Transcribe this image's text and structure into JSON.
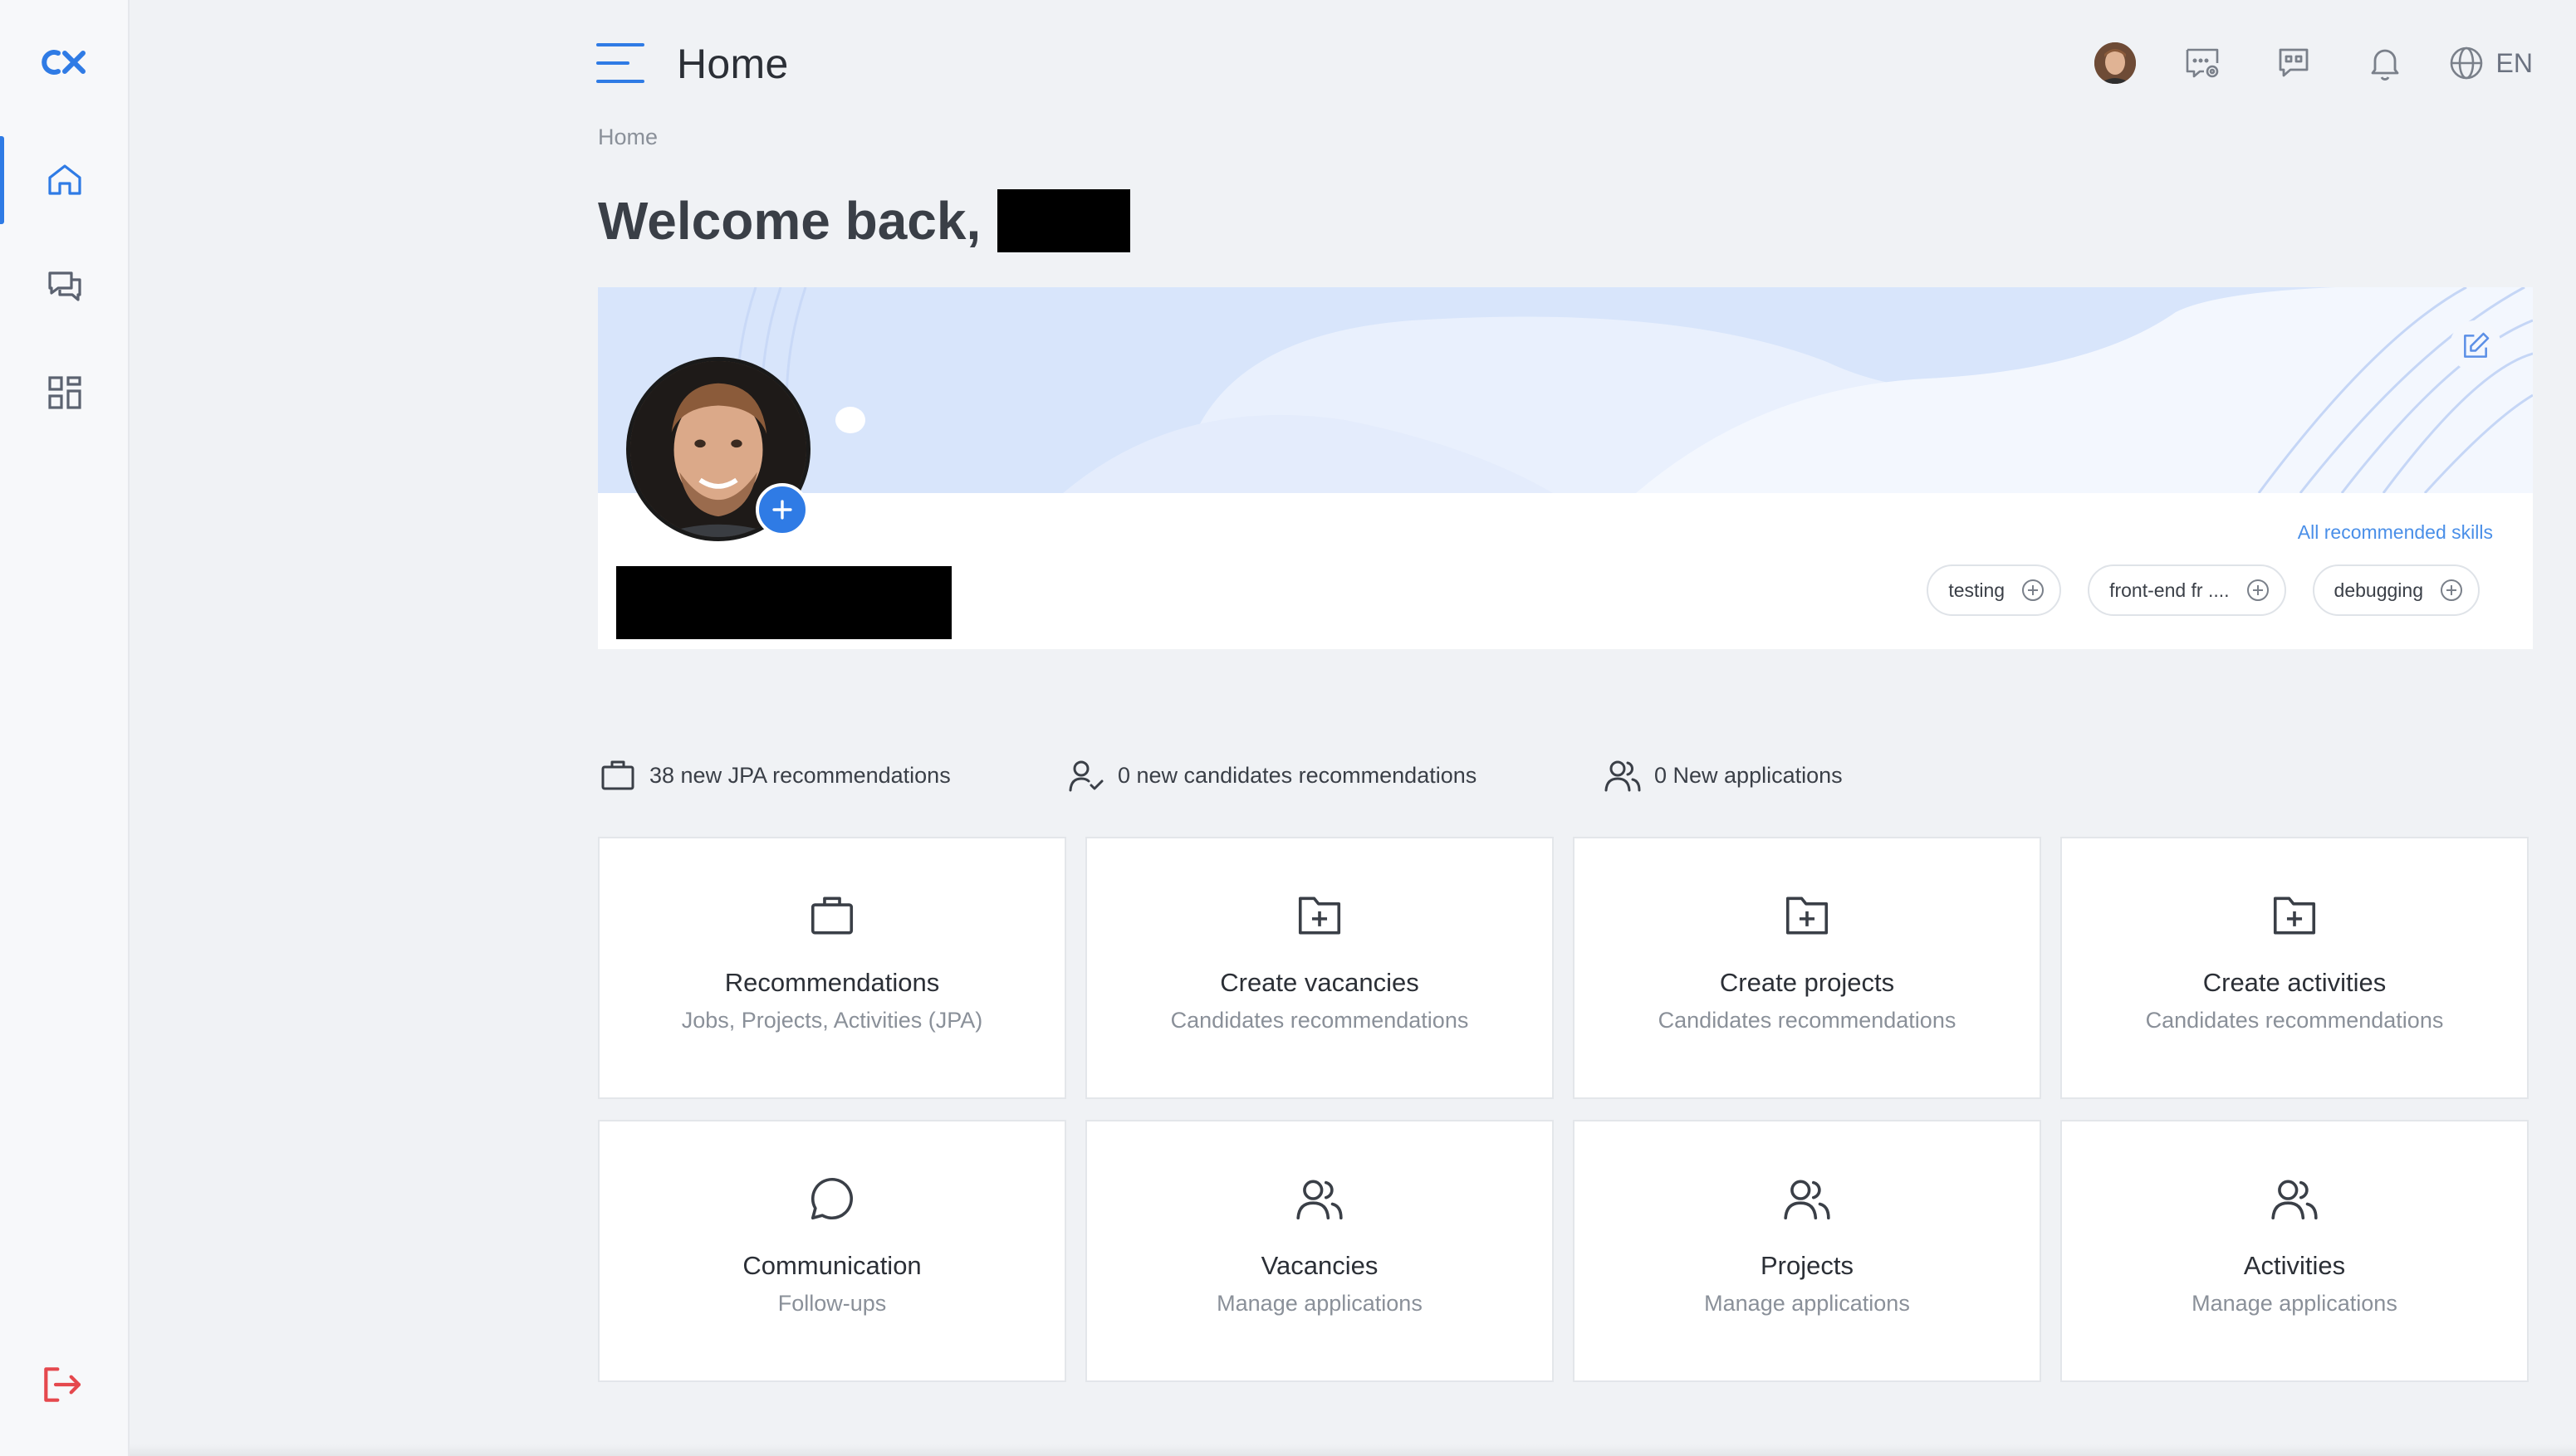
{
  "app": {
    "logo_text": "cx"
  },
  "header": {
    "title": "Home",
    "language": "EN"
  },
  "breadcrumb": "Home",
  "welcome": {
    "text": "Welcome back,"
  },
  "profile": {
    "all_skills_link": "All recommended skills",
    "skills": [
      "testing",
      "front-end fr ....",
      "debugging"
    ]
  },
  "stats": [
    {
      "icon": "briefcase-icon",
      "text": "38 new JPA recommendations"
    },
    {
      "icon": "user-check-icon",
      "text": "0 new candidates recommendations"
    },
    {
      "icon": "users-icon",
      "text": "0 New applications"
    }
  ],
  "tiles": [
    {
      "icon": "briefcase-icon",
      "title": "Recommendations",
      "subtitle": "Jobs, Projects, Activities (JPA)"
    },
    {
      "icon": "folder-plus-icon",
      "title": "Create vacancies",
      "subtitle": "Candidates recommendations"
    },
    {
      "icon": "folder-plus-icon",
      "title": "Create projects",
      "subtitle": "Candidates recommendations"
    },
    {
      "icon": "folder-plus-icon",
      "title": "Create activities",
      "subtitle": "Candidates recommendations"
    },
    {
      "icon": "chat-bubble-icon",
      "title": "Communication",
      "subtitle": "Follow-ups"
    },
    {
      "icon": "users-icon",
      "title": "Vacancies",
      "subtitle": "Manage applications"
    },
    {
      "icon": "users-icon",
      "title": "Projects",
      "subtitle": "Manage applications"
    },
    {
      "icon": "users-icon",
      "title": "Activities",
      "subtitle": "Manage applications"
    }
  ],
  "colors": {
    "accent": "#2f7be5",
    "logout": "#e5484d",
    "background": "#f0f2f5",
    "banner": "#d9e6fb"
  }
}
